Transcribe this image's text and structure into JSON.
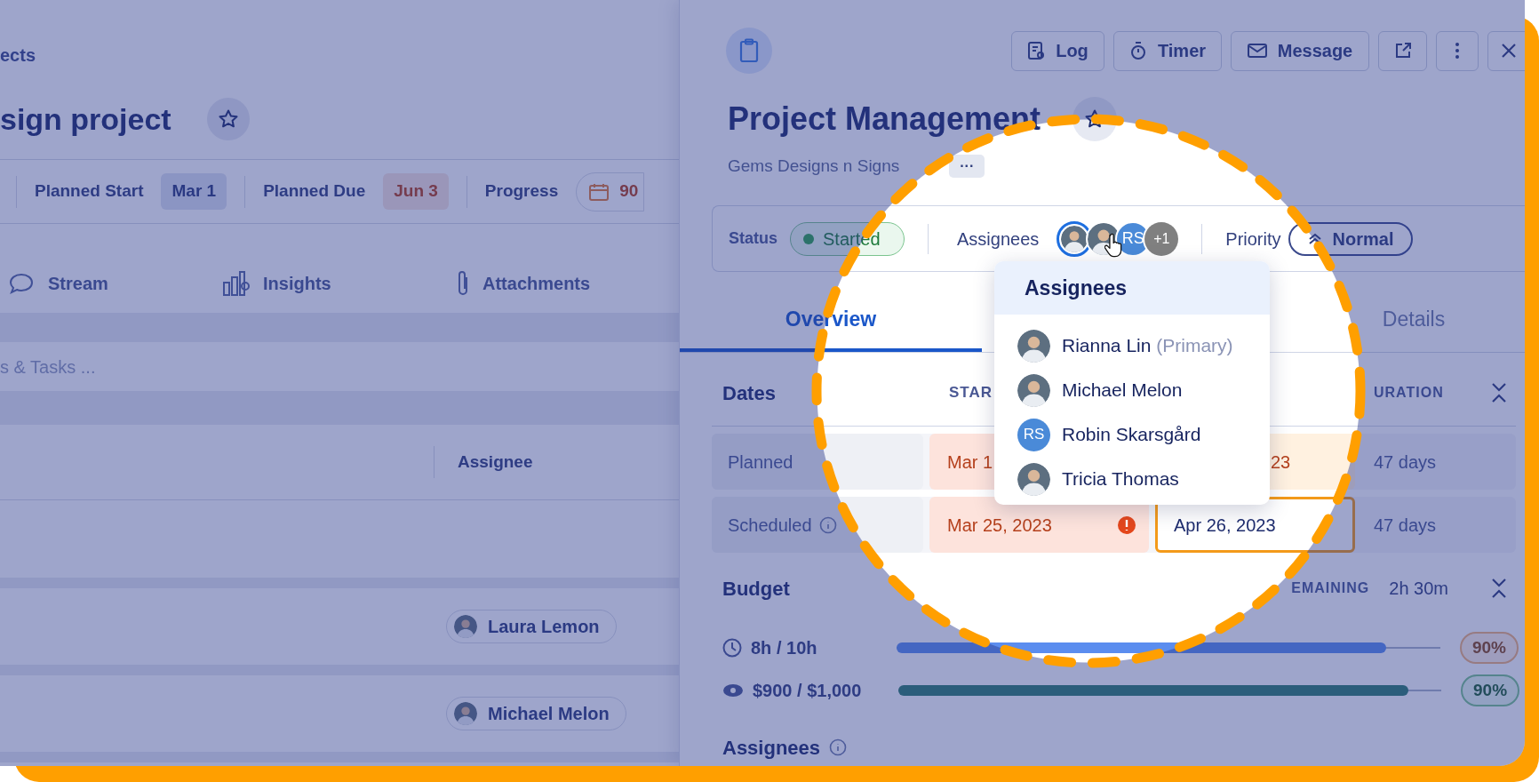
{
  "backdrop": {
    "breadcrumb": "ects",
    "title": "sign project",
    "meta": [
      {
        "label": "Planned Start",
        "value": "Mar 1",
        "overdue": false
      },
      {
        "label": "Planned Due",
        "value": "Jun 3",
        "overdue": true
      }
    ],
    "progress": {
      "label": "Progress",
      "value": "90"
    },
    "tabs": [
      {
        "label": "Stream"
      },
      {
        "label": "Insights"
      },
      {
        "label": "Attachments"
      }
    ],
    "search": {
      "placeholder": "s & Tasks ..."
    },
    "table": {
      "columns": [
        "Assignee"
      ],
      "rows": [
        {
          "assignee": "Laura Lemon"
        },
        {
          "assignee": "Michael Melon"
        }
      ]
    }
  },
  "panel": {
    "buttons": [
      {
        "label": "Log"
      },
      {
        "label": "Timer"
      },
      {
        "label": "Message"
      }
    ],
    "title": "Project Management",
    "client": "Gems Designs n Signs",
    "more": "···",
    "status": {
      "label": "Status",
      "value": "Started"
    },
    "assignees": {
      "label": "Assignees",
      "avatars": [
        {
          "kind": "photo",
          "selected": true
        },
        {
          "kind": "photo",
          "selected": false
        },
        {
          "kind": "initials",
          "text": "RS",
          "selected": false
        }
      ],
      "overflow": "+1"
    },
    "priority": {
      "label": "Priority",
      "value": "Normal"
    },
    "tabs": [
      {
        "label": "Overview",
        "selected": true
      },
      {
        "label": "Details",
        "selected": false
      }
    ],
    "dates": {
      "title": "Dates",
      "columns": [
        "STAR",
        "URATION"
      ],
      "rows": [
        {
          "label": "Planned",
          "info": false,
          "start": "Mar 1",
          "end": "23",
          "end_focus": false,
          "duration": "47 days"
        },
        {
          "label": "Scheduled",
          "info": true,
          "start": "Mar 25, 2023",
          "start_alert": true,
          "end": "Apr 26, 2023",
          "end_focus": true,
          "duration": "47 days"
        }
      ]
    },
    "budget": {
      "title": "Budget",
      "remaining_label": "EMAINING",
      "remaining": "2h 30m",
      "rows": [
        {
          "kind": "time",
          "amount": "8h / 10h",
          "level": 0.9,
          "percent": "90%",
          "warning": true
        },
        {
          "kind": "money",
          "amount": "$900 / $1,000",
          "level": 0.94,
          "percent": "90%",
          "warning": false
        }
      ]
    },
    "assignees_section": "Assignees"
  },
  "dropdown": {
    "title": "Assignees",
    "items": [
      {
        "name": "Rianna Lin",
        "note": "(Primary)",
        "kind": "photo"
      },
      {
        "name": "Michael Melon",
        "kind": "photo"
      },
      {
        "name": "Robin Skarsgård",
        "kind": "initials",
        "initials": "RS"
      },
      {
        "name": "Tricia Thomas",
        "kind": "photo"
      }
    ]
  }
}
